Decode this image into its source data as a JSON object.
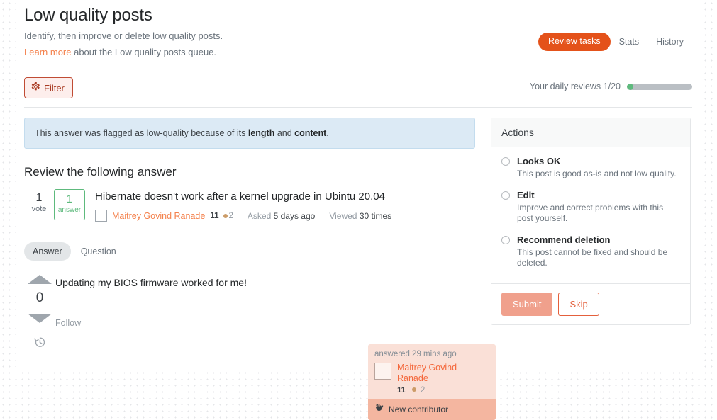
{
  "header": {
    "title": "Low quality posts",
    "subtitle": "Identify, then improve or delete low quality posts.",
    "learn_more_label": "Learn more",
    "learn_more_suffix": " about the Low quality posts queue.",
    "nav": {
      "review_tasks": "Review tasks",
      "stats": "Stats",
      "history": "History"
    }
  },
  "toolbar": {
    "filter_label": "Filter",
    "daily_reviews_label": "Your daily reviews 1/20",
    "progress": {
      "current": 1,
      "total": 20,
      "fill_color": "#5eba7d",
      "track_color": "#babfc4"
    }
  },
  "notice": {
    "prefix": "This answer was flagged as low-quality because of its ",
    "reason1": "length",
    "joiner": " and ",
    "reason2": "content",
    "suffix": "."
  },
  "main": {
    "section_title": "Review the following answer",
    "question": {
      "votes": "1",
      "votes_label": "vote",
      "answers": "1",
      "answers_label": "answer",
      "title": "Hibernate doesn't work after a kernel upgrade in Ubintu 20.04",
      "author": "Maitrey Govind Ranade",
      "reputation": "11",
      "bronze_badges": "2",
      "asked_label": "Asked",
      "asked_value": "5 days ago",
      "viewed_label": "Viewed",
      "viewed_value": "30 times"
    },
    "tabs": [
      {
        "label": "Answer",
        "active": true
      },
      {
        "label": "Question",
        "active": false
      }
    ],
    "post": {
      "score": "0",
      "text": "Updating my BIOS firmware worked for me!",
      "follow_label": "Follow"
    },
    "signature": {
      "time": "answered 29 mins ago",
      "name": "Maitrey Govind Ranade",
      "reputation": "11",
      "bronze_badges": "2",
      "new_contributor_label": "New contributor"
    }
  },
  "actions": {
    "title": "Actions",
    "options": [
      {
        "label": "Looks OK",
        "description": "This post is good as-is and not low quality.",
        "selected": false
      },
      {
        "label": "Edit",
        "description": "Improve and correct problems with this post yourself.",
        "selected": false
      },
      {
        "label": "Recommend deletion",
        "description": "This post cannot be fixed and should be deleted.",
        "selected": false
      }
    ],
    "submit_label": "Submit",
    "skip_label": "Skip"
  },
  "colors": {
    "accent_orange": "#e4521a",
    "link_orange": "#f4814c",
    "filter_border": "#c04c34",
    "notice_bg": "#dceaf5",
    "answer_green": "#5eba7d",
    "signature_bg": "#fae0d7",
    "new_contributor_bg": "#f4b6a0"
  }
}
